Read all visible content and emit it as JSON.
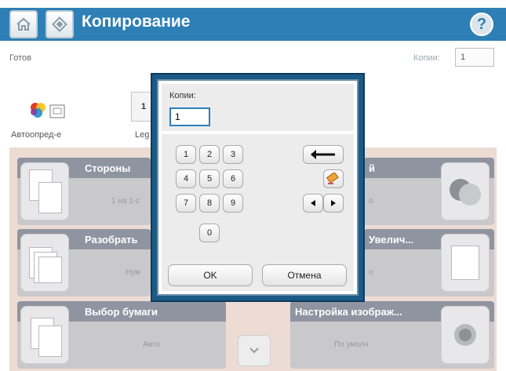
{
  "header": {
    "title": "Копирование",
    "home_icon": "home-icon",
    "app_icon": "copy-diamond-icon",
    "help_icon": "help-icon",
    "help_symbol": "?",
    "accent_color": "#2d7fb6"
  },
  "status": {
    "text": "Готов",
    "copies_label": "Копии:",
    "copies_value": "1"
  },
  "color_mode": {
    "label": "Автоопред-е",
    "icon": "color-mode-icon"
  },
  "paper_size": {
    "button_text": "1",
    "label": "Leg"
  },
  "features": [
    {
      "title": "Стороны",
      "value": "1 на 1-с",
      "icon": "sides-icon"
    },
    {
      "title": "Разобрать",
      "value": "Нум",
      "icon": "collate-icon"
    },
    {
      "title": "Выбор бумаги",
      "value": "Авто",
      "icon": "paper-select-icon"
    },
    {
      "title": "й",
      "value": "о",
      "icon": "darker-lighter-icon"
    },
    {
      "title": "Увелич...",
      "value": "о",
      "icon": "reduce-enlarge-icon"
    },
    {
      "title": "Настройка изображ...",
      "value": "По умолч",
      "icon": "image-adjust-icon"
    }
  ],
  "scroll_icon": "chevron-down-icon",
  "dialog": {
    "label": "Копии:",
    "input_value": "1",
    "keys": [
      "1",
      "2",
      "3",
      "4",
      "5",
      "6",
      "7",
      "8",
      "9",
      "0"
    ],
    "backspace_icon": "backspace-arrow-icon",
    "clear_icon": "eraser-icon",
    "left_icon": "arrow-left-icon",
    "right_icon": "arrow-right-icon",
    "ok_label": "OK",
    "cancel_label": "Отмена"
  }
}
